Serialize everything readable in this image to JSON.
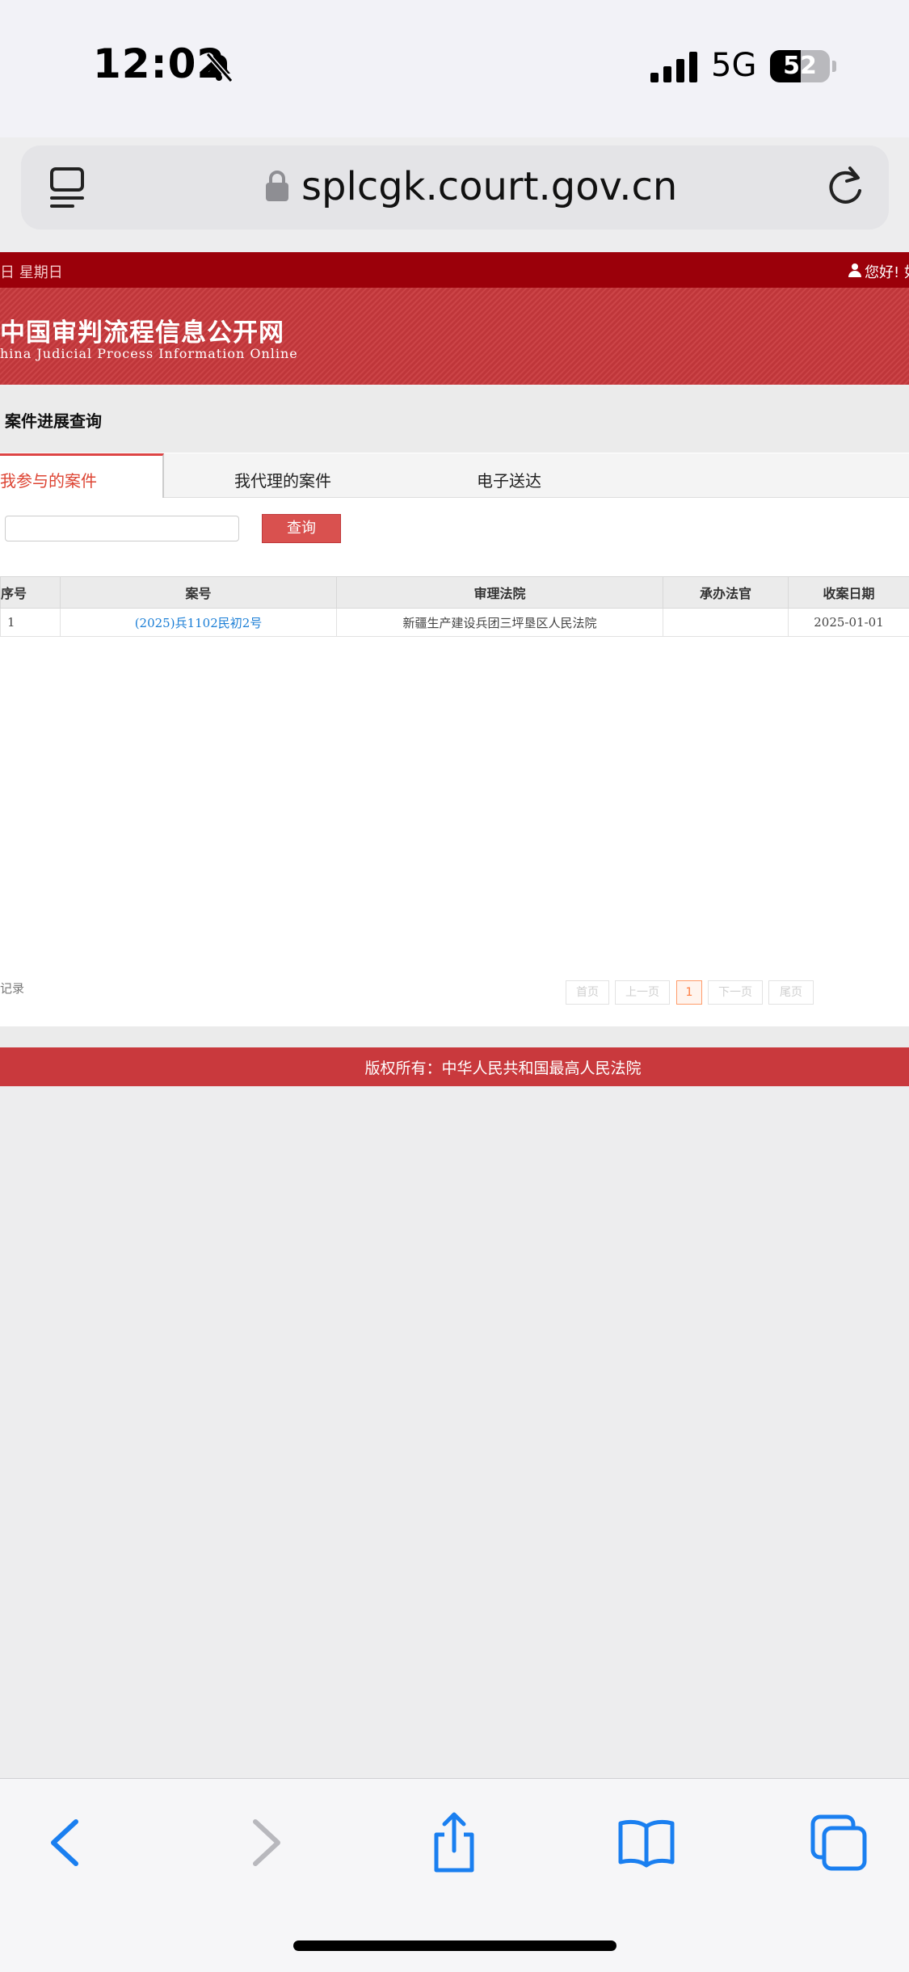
{
  "status_bar": {
    "time": "12:02",
    "network": "5G",
    "battery": "52",
    "battery_level": 0.52
  },
  "browser": {
    "url": "splcgk.court.gov.cn"
  },
  "site": {
    "date_text": "日 星期日",
    "user_text": "您好! 如",
    "title": "中国审判流程信息公开网",
    "subtitle": "hina Judicial Process Information Online",
    "section_title": "案件进展查询"
  },
  "tabs": [
    {
      "label": "我参与的案件",
      "active": true
    },
    {
      "label": "我代理的案件",
      "active": false
    },
    {
      "label": "电子送达",
      "active": false
    }
  ],
  "search": {
    "button_label": "查询",
    "placeholder": ""
  },
  "table": {
    "headers": [
      "序号",
      "案号",
      "审理法院",
      "承办法官",
      "收案日期"
    ],
    "rows": [
      [
        "1",
        "(2025)兵1102民初2号",
        "新疆生产建设兵团三坪垦区人民法院",
        "",
        "2025-01-01"
      ]
    ]
  },
  "pagination": {
    "records_text": "记录",
    "first": "首页",
    "prev": "上一页",
    "current": "1",
    "next": "下一页",
    "last": "尾页"
  },
  "footer": {
    "text": "版权所有：中华人民共和国最高人民法院"
  },
  "colors": {
    "brand_red": "#c9393d",
    "dark_red": "#9b000a",
    "link_blue": "#1a7ed6",
    "ios_blue": "#1a7ff0"
  },
  "toolbar_icons": [
    "back-icon",
    "forward-icon",
    "share-icon",
    "bookmarks-icon",
    "tabs-icon"
  ]
}
